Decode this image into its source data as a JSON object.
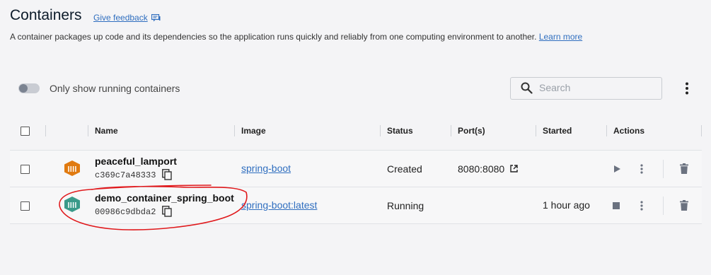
{
  "header": {
    "title": "Containers",
    "feedback_link": "Give feedback",
    "description": "A container packages up code and its dependencies so the application runs quickly and reliably from one computing environment to another.",
    "learn_more": "Learn more"
  },
  "toolbar": {
    "toggle_label": "Only show running containers",
    "toggle_on": false,
    "search_placeholder": "Search"
  },
  "table": {
    "columns": [
      "Name",
      "Image",
      "Status",
      "Port(s)",
      "Started",
      "Actions"
    ],
    "rows": [
      {
        "name": "peaceful_lamport",
        "id": "c369c7a48333",
        "image": "spring-boot",
        "status": "Created",
        "ports": "8080:8080",
        "started": "",
        "icon_color": "#e07a10",
        "primary_action": "start-icon"
      },
      {
        "name": "demo_container_spring_boot",
        "id": "00986c9dbda2",
        "image": "spring-boot:latest",
        "status": "Running",
        "ports": "",
        "started": "1 hour ago",
        "icon_color": "#3a9a8a",
        "primary_action": "stop-icon"
      }
    ]
  },
  "annotation": {
    "color": "#e0191c"
  }
}
